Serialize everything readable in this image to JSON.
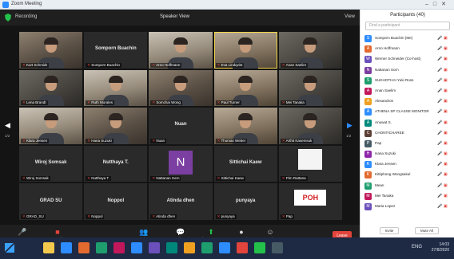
{
  "window": {
    "title": "Zoom Meeting"
  },
  "top": {
    "recording": "Recording",
    "speaker": "Speaker View",
    "view": "View"
  },
  "tiles": [
    {
      "big": "",
      "caption": "Kurt Schmidt",
      "kind": "video"
    },
    {
      "big": "Somporn Buachin",
      "caption": "Somporn Buachin",
      "kind": "name"
    },
    {
      "big": "",
      "caption": "Arno Hoffmann",
      "kind": "video b"
    },
    {
      "big": "",
      "caption": "Eva Lindqvist",
      "kind": "video d active"
    },
    {
      "big": "",
      "caption": "Anan Saelim",
      "kind": "video c"
    },
    {
      "big": "",
      "caption": "Lena Brandt",
      "kind": "video c"
    },
    {
      "big": "",
      "caption": "Ruth Morales",
      "kind": "video b"
    },
    {
      "big": "",
      "caption": "Somchai Wong",
      "kind": "video"
    },
    {
      "big": "",
      "caption": "Paul Turner",
      "kind": "video d"
    },
    {
      "big": "",
      "caption": "Mei Tanaka",
      "kind": "video c"
    },
    {
      "big": "",
      "caption": "Klara Jensen",
      "kind": "video b"
    },
    {
      "big": "",
      "caption": "Hana Suzuki",
      "kind": "video"
    },
    {
      "big": "Nuan",
      "caption": "Nuan",
      "kind": "name"
    },
    {
      "big": "",
      "caption": "Thomas Weber",
      "kind": "video d"
    },
    {
      "big": "",
      "caption": "Arthit Kasemsuk",
      "kind": "video c"
    },
    {
      "big": "Wiroj Somsak",
      "caption": "Wiroj Somsak",
      "kind": "name"
    },
    {
      "big": "Nutthaya T.",
      "caption": "Nutthaya T.",
      "kind": "name"
    },
    {
      "big": "",
      "caption": "Nattanan Sorn",
      "kind": "avatar-n"
    },
    {
      "big": "Sittichai Kaew",
      "caption": "Sittichai Kaew",
      "kind": "name"
    },
    {
      "big": "",
      "caption": "Pim Rattana",
      "kind": "sketch"
    },
    {
      "big": "GRAD SU",
      "caption": "GRAD_SU",
      "kind": "name"
    },
    {
      "big": "Noppol",
      "caption": "Noppol",
      "kind": "name"
    },
    {
      "big": "Atinda dhen",
      "caption": "Atinda dhen",
      "kind": "name"
    },
    {
      "big": "punyaya",
      "caption": "punyaya",
      "kind": "name"
    },
    {
      "big": "",
      "caption": "Pap",
      "kind": "poh"
    }
  ],
  "avatar_letter": "N",
  "poh_text": "POH",
  "pager": {
    "left": "1/2",
    "right": "1/2"
  },
  "toolbar": [
    {
      "icon": "mic-icon",
      "glyph": "🎤",
      "label": "Unmute",
      "tone": "red"
    },
    {
      "icon": "video-icon",
      "glyph": "■",
      "label": "Start Video",
      "tone": "red"
    },
    {
      "icon": "participants-icon",
      "glyph": "👥",
      "label": "Participants",
      "tone": ""
    },
    {
      "icon": "chat-icon",
      "glyph": "💬",
      "label": "Chat",
      "tone": ""
    },
    {
      "icon": "share-icon",
      "glyph": "⬆",
      "label": "Share Screen",
      "tone": "green"
    },
    {
      "icon": "record-icon",
      "glyph": "●",
      "label": "Record",
      "tone": ""
    },
    {
      "icon": "reactions-icon",
      "glyph": "☺",
      "label": "Reactions",
      "tone": ""
    }
  ],
  "leave": "Leave",
  "panel": {
    "title": "Participants (40)",
    "search_placeholder": "Find a participant",
    "items": [
      {
        "name": "Somporn Buachin (Me)",
        "initial": "S",
        "color": "#2d8cff"
      },
      {
        "name": "Arno Hoffmann",
        "initial": "A",
        "color": "#e36a2f"
      },
      {
        "name": "Werner Schneider (Co-host)",
        "initial": "W",
        "color": "#6b4fbb"
      },
      {
        "name": "Nattanan Sorn",
        "initial": "N",
        "color": "#7b3fa1"
      },
      {
        "name": "SUKHOTHAI Yuki Ross",
        "initial": "S",
        "color": "#1e9e6e"
      },
      {
        "name": "Anan Saelim",
        "initial": "A",
        "color": "#c2185b"
      },
      {
        "name": "Alexandros",
        "initial": "A",
        "color": "#f0a020"
      },
      {
        "name": "ATHENA SP CLASSE MONITOR",
        "initial": "A",
        "color": "#2d8cff"
      },
      {
        "name": "Anuwat S.",
        "initial": "A",
        "color": "#00897b"
      },
      {
        "name": "CHONTICHAREE",
        "initial": "C",
        "color": "#5d4037"
      },
      {
        "name": "Pap",
        "initial": "P",
        "color": "#455a64"
      },
      {
        "name": "Hana Suzuki",
        "initial": "H",
        "color": "#8e24aa"
      },
      {
        "name": "Klara Jensen",
        "initial": "K",
        "color": "#2d8cff"
      },
      {
        "name": "Kittiphong Wongsakul",
        "initial": "K",
        "color": "#e36a2f"
      },
      {
        "name": "Mean",
        "initial": "M",
        "color": "#1e9e6e"
      },
      {
        "name": "Mei Tanaka",
        "initial": "M",
        "color": "#c2185b"
      },
      {
        "name": "Maria Lopez",
        "initial": "M",
        "color": "#6b4fbb"
      }
    ],
    "invite": "Invite",
    "mute_all": "Mute All"
  },
  "tray": {
    "status": "ENG",
    "time": "14:03",
    "date": "27/8/2020"
  }
}
